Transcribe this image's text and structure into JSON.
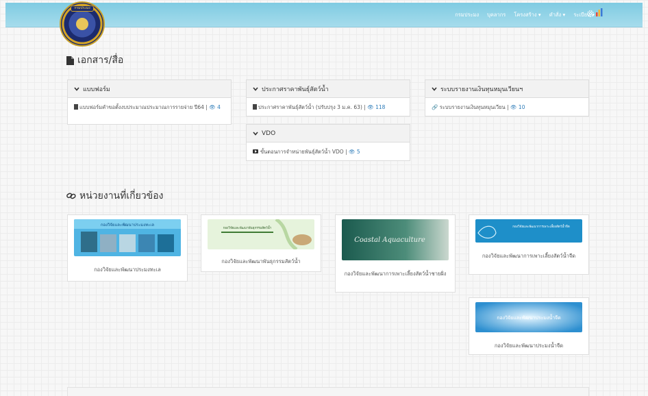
{
  "header": {
    "logo_text": "กรมประมง",
    "nav": [
      "กรมประมง",
      "บุคลากร",
      "โครงสร้าง ▾",
      "คำสั่ง ▾",
      "ระเบียบ ▾"
    ]
  },
  "documents": {
    "title": "เอกสาร/สื่อ",
    "forms": {
      "heading": "แบบฟอร์ม",
      "item": "แบบฟอร์มคำขอตั้งงบประมาณประมาณการรายจ่าย ปี64",
      "views": "4"
    },
    "announcement": {
      "heading": "ประกาศราคาพันธุ์สัตว์น้ำ",
      "item": "ประกาศราคาพันธุ์สัตว์น้ำ (ปรับปรุง 3 ม.ค. 63)",
      "views": "118"
    },
    "report": {
      "heading": "ระบบรายงานเงินทุนหมุนเวียนฯ",
      "item": "ระบบรายงานเงินทุนหมุนเวียน",
      "views": "10"
    },
    "vdo": {
      "heading": "VDO",
      "item": "ขั้นตอนการจำหน่ายพันธุ์สัตว์น้ำ VDO",
      "views": "5"
    }
  },
  "related": {
    "title": "หน่วยงานที่เกี่ยวข้อง",
    "cards": [
      {
        "caption": "กองวิจัยและพัฒนาประมงทะเล",
        "banner": "กองวิจัยและพัฒนาประมงทะเล"
      },
      {
        "caption": "กองวิจัยและพัฒนาพันธุกรรมสัตว์น้ำ",
        "banner": "กองวิจัยและพัฒนาพันธุกรรมสัตว์น้ำ"
      },
      {
        "caption": "กองวิจัยและพัฒนาการเพาะเลี้ยงสัตว์น้ำชายฝั่ง",
        "banner": "Coastal Aquaculture"
      },
      {
        "caption": "กองวิจัยและพัฒนาการเพาะเลี้ยงสัตว์น้ำจืด",
        "banner": "กองวิจัยและพัฒนาการเพาะเลี้ยงสัตว์น้ำจืด"
      },
      {
        "caption": "กองวิจัยและพัฒนาประมงน้ำจืด",
        "banner": "กองวิจัยและพัฒนาประมงน้ำจืด"
      }
    ]
  },
  "colors": {
    "header": "#8fd0e6",
    "link": "#2a7ab8"
  },
  "icons": [
    "document-icon",
    "chevron-down-icon",
    "eye-icon",
    "link-icon",
    "youtube-icon",
    "gear-icon",
    "bar-chart-icon"
  ]
}
